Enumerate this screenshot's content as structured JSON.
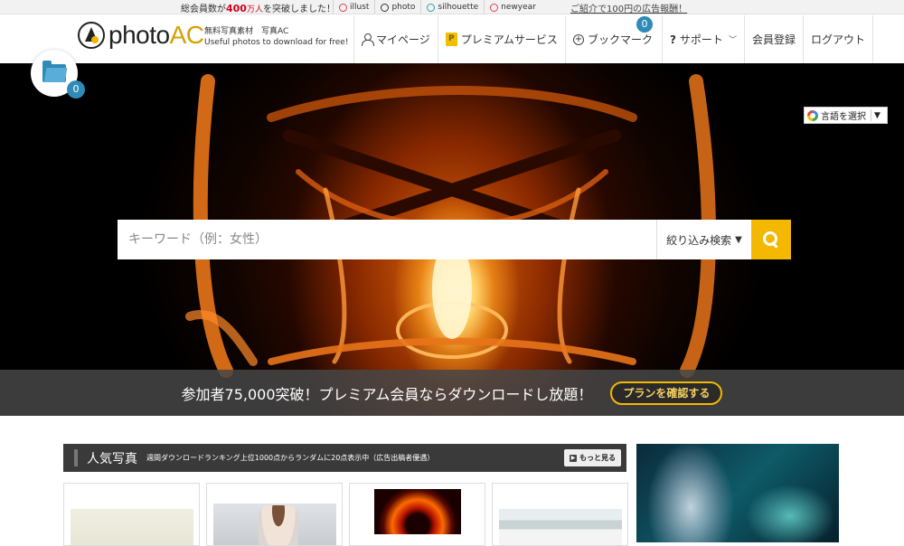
{
  "topbar": {
    "notice_prefix": "総会員数が",
    "notice_number": "400",
    "notice_unit": "万人",
    "notice_suffix": "を突破しました！",
    "sites": [
      {
        "label": "illust",
        "color": "#e0405a"
      },
      {
        "label": "photo",
        "color": "#333333"
      },
      {
        "label": "silhouette",
        "color": "#2aa3a0"
      },
      {
        "label": "newyear",
        "color": "#e0405a"
      }
    ],
    "referral": "ご紹介で100円の広告報酬！"
  },
  "header": {
    "logo_text_a": "photo",
    "logo_text_b": "AC",
    "tagline_line1": "無料写真素材　写真AC",
    "tagline_line2": "Useful photos to download for free!",
    "nav": {
      "mypage": "マイページ",
      "premium": "プレミアムサービス",
      "premium_icon_letter": "P",
      "bookmark": "ブックマーク",
      "bookmark_count": "0",
      "support": "サポート",
      "register": "会員登録",
      "logout": "ログアウト"
    }
  },
  "folder": {
    "count": "0"
  },
  "hero": {
    "lang_select": "言語を選択",
    "lang_arrow": "▼",
    "search_placeholder": "キーワード（例：女性）",
    "filter_label": "絞り込み検索",
    "filter_arrow": "▼",
    "promo_text": "参加者75,000突破！プレミアム会員ならダウンロードし放題！",
    "promo_button": "プランを確認する"
  },
  "popular": {
    "title": "人気写真",
    "subtitle": "週間ダウンロードランキング上位1000点からランダムに20点表示中（広告出稿者優遇）",
    "more_label": "もっと見る"
  },
  "colors": {
    "accent_yellow": "#f5b800",
    "badge_blue": "#2f8ab8",
    "dark_bar": "#3a3a3a"
  }
}
